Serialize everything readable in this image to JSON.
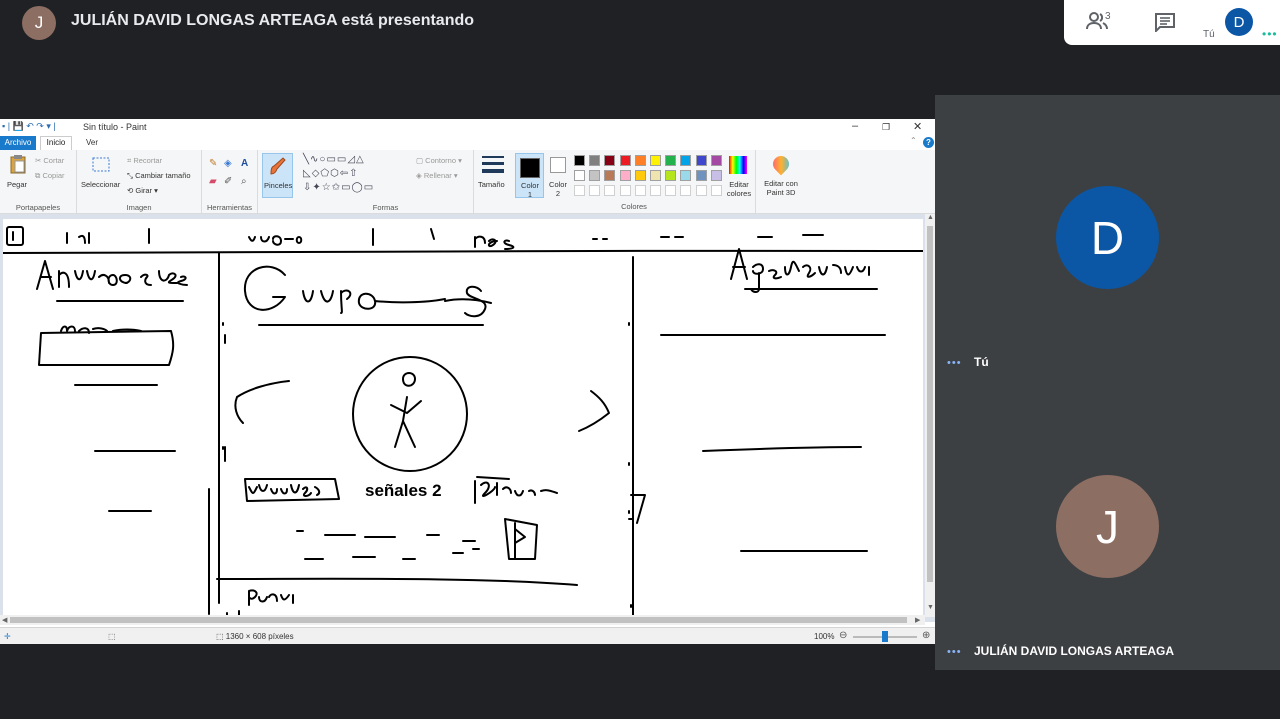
{
  "meet": {
    "presenter_initial": "J",
    "presenter_text": "JULIÁN DAVID LONGAS ARTEAGA está presentando",
    "participants_count": "3",
    "me_initial": "D",
    "me_label": "Tú"
  },
  "paint": {
    "title": "Sin título - Paint",
    "menu": {
      "archivo": "Archivo",
      "inicio": "Inicio",
      "ver": "Ver"
    },
    "ribbon": {
      "pegar": "Pegar",
      "cortar": "Cortar",
      "copiar": "Copiar",
      "portapapeles": "Portapapeles",
      "seleccionar": "Seleccionar",
      "recortar": "Recortar",
      "cambiar_tamano": "Cambiar tamaño",
      "girar": "Girar",
      "imagen": "Imagen",
      "herramientas": "Herramientas",
      "pinceles": "Pinceles",
      "contorno": "Contorno",
      "rellenar": "Rellenar",
      "formas": "Formas",
      "tamano": "Tamaño",
      "color1": "Color 1",
      "color2": "Color 2",
      "editar_colores": "Editar colores",
      "editar_paint3d": "Editar con Paint 3D",
      "colores": "Colores"
    },
    "palette_row1": [
      "#000000",
      "#7f7f7f",
      "#880015",
      "#ed1c24",
      "#ff7f27",
      "#fff200",
      "#22b14c",
      "#00a2e8",
      "#3f48cc",
      "#a349a4"
    ],
    "palette_row2": [
      "#ffffff",
      "#c3c3c3",
      "#b97a57",
      "#ffaec9",
      "#ffc90e",
      "#efe4b0",
      "#b5e61d",
      "#99d9ea",
      "#7092be",
      "#c8bfe7"
    ],
    "canvas_text": "señales 2",
    "status": {
      "dimensions": "1360 × 608 píxeles",
      "zoom": "100%"
    }
  },
  "sidebar": {
    "tile1_initial": "D",
    "tile1_name": "Tú",
    "tile1_color": "#0b57a6",
    "tile2_initial": "J",
    "tile2_name": "JULIÁN DAVID LONGAS ARTEAGA",
    "tile2_color": "#8d6e63"
  }
}
